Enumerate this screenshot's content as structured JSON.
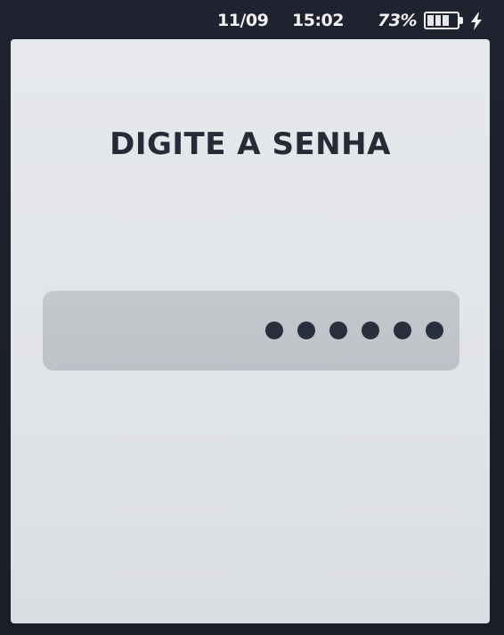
{
  "status_bar": {
    "date": "11/09",
    "time": "15:02",
    "battery_percent": "73%",
    "battery_icon": "battery-charging-icon",
    "charging_icon": "lightning-bolt-icon"
  },
  "screen": {
    "title": "DIGITE A SENHA",
    "password_field": {
      "masked_value": "••••••",
      "dot_count": 6
    }
  },
  "colors": {
    "status_bar_bg": "#20232f",
    "screen_bg": "#e3e6e9",
    "field_bg": "#c2c5ca",
    "dot": "#2a2f3e",
    "title_text": "#272b38"
  }
}
